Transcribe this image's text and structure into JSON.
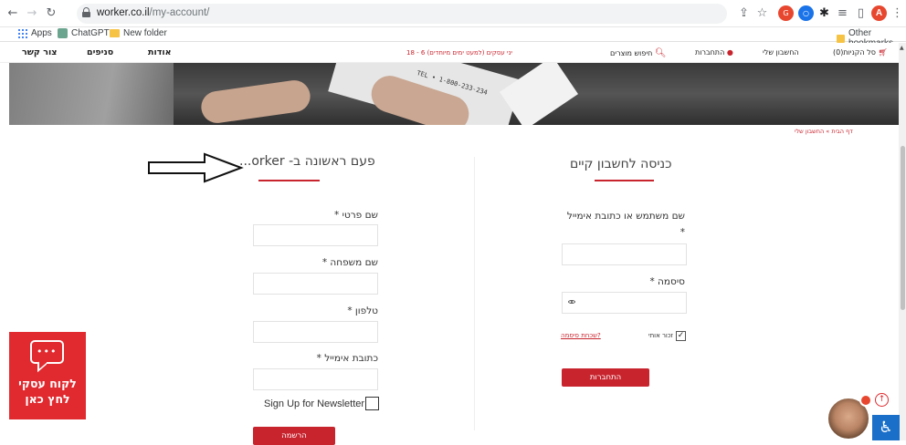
{
  "browser": {
    "url_domain": "worker.co.il",
    "url_path": "/my-account/",
    "bookmarks": [
      "Apps",
      "ChatGPT",
      "New folder"
    ],
    "other_bookmarks": "Other bookmarks",
    "profile_initial": "A"
  },
  "site_nav": {
    "contact": "צור קשר",
    "branches": "סניפים",
    "about": "אודות",
    "promo": "18 - 6 יני עסקים (למעט ימים מיוחדים)",
    "product_search": "חיפוש מוצרים",
    "login": "התחברות",
    "my_account": "החשבון שלי",
    "cart": "סל הקניות(0)"
  },
  "hero": {
    "phone_text": "TEL • 1-800-233-234"
  },
  "breadcrumb": "דף הבית » החשבון שלי",
  "login_form": {
    "title": "כניסה לחשבון קיים",
    "username_label": "שם משתמש או כתובת אימייל",
    "required_mark": "*",
    "password_label": "סיסמה *",
    "remember_me": "זכור אותי",
    "forgot_password": "שכחת סיסמה?",
    "submit": "התחברות"
  },
  "register_form": {
    "title": "פעם ראשונה ב- orker...",
    "first_name_label": "שם פרטי *",
    "last_name_label": "שם משפחה *",
    "phone_label": "טלפון *",
    "email_label": "כתובת אימייל *",
    "newsletter_label": "Sign Up for Newsletter",
    "submit": "הרשמה"
  },
  "chat_widget": {
    "dots": "•••",
    "line1": "לקוח עסקי",
    "line2": "לחץ כאן"
  },
  "colors": {
    "brand_red": "#c8242e",
    "widget_red": "#e02a2f",
    "accessibility_blue": "#1a6fc9"
  }
}
